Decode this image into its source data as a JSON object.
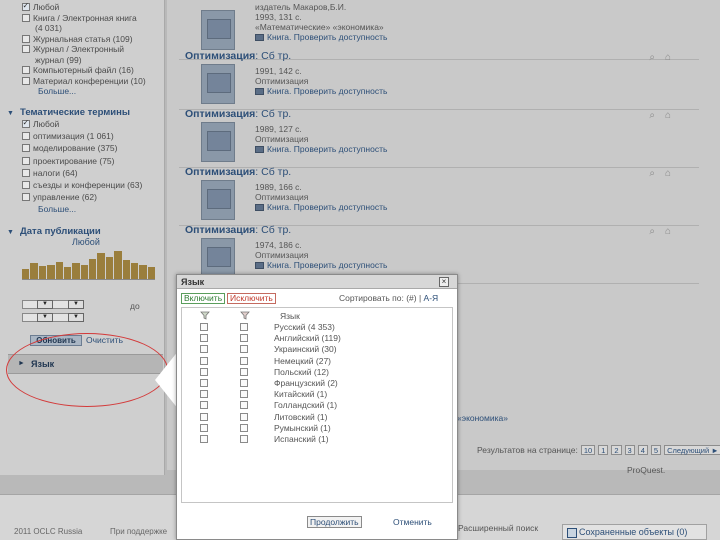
{
  "source_types": {
    "items": [
      {
        "label": "Любой",
        "checked": true,
        "indent": false
      },
      {
        "label": "Книга / Электронная книга",
        "checked": false,
        "indent": false
      },
      {
        "label": "(4 031)",
        "checked": null,
        "indent": true
      },
      {
        "label": "Журнальная статья (109)",
        "checked": false,
        "indent": false
      },
      {
        "label": "Журнал / Электронный",
        "checked": false,
        "indent": false
      },
      {
        "label": "журнал (99)",
        "checked": null,
        "indent": true
      },
      {
        "label": "Компьютерный файл (16)",
        "checked": false,
        "indent": false
      },
      {
        "label": "Материал конференции (10)",
        "checked": false,
        "indent": false
      }
    ],
    "more": "Больше..."
  },
  "thematic": {
    "title": "Тематические термины",
    "items": [
      {
        "label": "Любой",
        "checked": true
      },
      {
        "label": "оптимизация (1 061)",
        "checked": false
      },
      {
        "label": "моделирование (375)",
        "checked": false
      },
      {
        "label": "проектирование (75)",
        "checked": false
      },
      {
        "label": "налоги (64)",
        "checked": false
      },
      {
        "label": "съезды и конференции (63)",
        "checked": false
      },
      {
        "label": "управление (62)",
        "checked": false
      }
    ],
    "more": "Больше..."
  },
  "pubdate": {
    "title": "Дата публикации",
    "value": "Любой",
    "histogram": [
      0.35,
      0.55,
      0.45,
      0.5,
      0.6,
      0.4,
      0.55,
      0.5,
      0.7,
      0.9,
      0.75,
      0.95,
      0.65,
      0.55,
      0.5,
      0.4
    ],
    "to_label": "до",
    "sel_icon": "▼"
  },
  "buttons": {
    "update": "Обновить",
    "clear": "Очистить"
  },
  "language_facet": {
    "label": "Язык",
    "arrow": "►"
  },
  "results": [
    {
      "title": "",
      "subtitle": "",
      "l1": "издатель Макаров,Б.И.",
      "l2": "1993, 131 с.",
      "l3": "«Математические» «экономика»",
      "l4": "Книга. Проверить доступность"
    },
    {
      "title": "Оптимизация",
      "subtitle": ": Сб тр.",
      "l1": "1991, 142 с.",
      "l2": "Оптимизация",
      "l3": "",
      "l4": "Книга. Проверить доступность"
    },
    {
      "title": "Оптимизация",
      "subtitle": ": Сб тр.",
      "l1": "1989, 127 с.",
      "l2": "Оптимизация",
      "l3": "",
      "l4": "Книга. Проверить доступность"
    },
    {
      "title": "Оптимизация",
      "subtitle": ": Сб тр.",
      "l1": "1989, 166 с.",
      "l2": "Оптимизация",
      "l3": "",
      "l4": "Книга. Проверить доступность"
    },
    {
      "title": "Оптимизация",
      "subtitle": ": Сб тр.",
      "l1": "1974, 186 с.",
      "l2": "Оптимизация",
      "l3": "",
      "l4": "Книга. Проверить доступность"
    }
  ],
  "pager": {
    "label": "Результатов на странице:",
    "per_page": "10",
    "pages": [
      "1",
      "2",
      "3",
      "4",
      "5"
    ],
    "next": "Следующий ►"
  },
  "partial_texts": {
    "keyword_tail": "«экономика»",
    "proquest": "ProQuest."
  },
  "footer": {
    "copyright": "2011 OCLC Russia",
    "support": "При поддержке",
    "advanced_search": "Расширенный поиск",
    "saved_items": "Сохраненные объекты (0)"
  },
  "modal": {
    "title": "Язык",
    "close": "×",
    "include": "Включить",
    "exclude": "Исключить",
    "sort_label": "Сортировать по: ",
    "sort_count": "(#)",
    "sort_sep": " | ",
    "sort_alpha": "А-Я",
    "column_header": "Язык",
    "languages": [
      "Русский (4 353)",
      "Английский (119)",
      "Украинский (30)",
      "Немецкий (27)",
      "Польский (12)",
      "Французский (2)",
      "Китайский (1)",
      "Голландский (1)",
      "Литовский (1)",
      "Румынский (1)",
      "Испанский (1)"
    ],
    "continue": "Продолжить",
    "cancel": "Отменить"
  },
  "colors": {
    "accent": "#2d4f78",
    "include_green": "#2e7d32",
    "exclude_red": "#c0392b",
    "callout_red": "#d33a3a",
    "histogram_bar": "#9a7e3c"
  }
}
